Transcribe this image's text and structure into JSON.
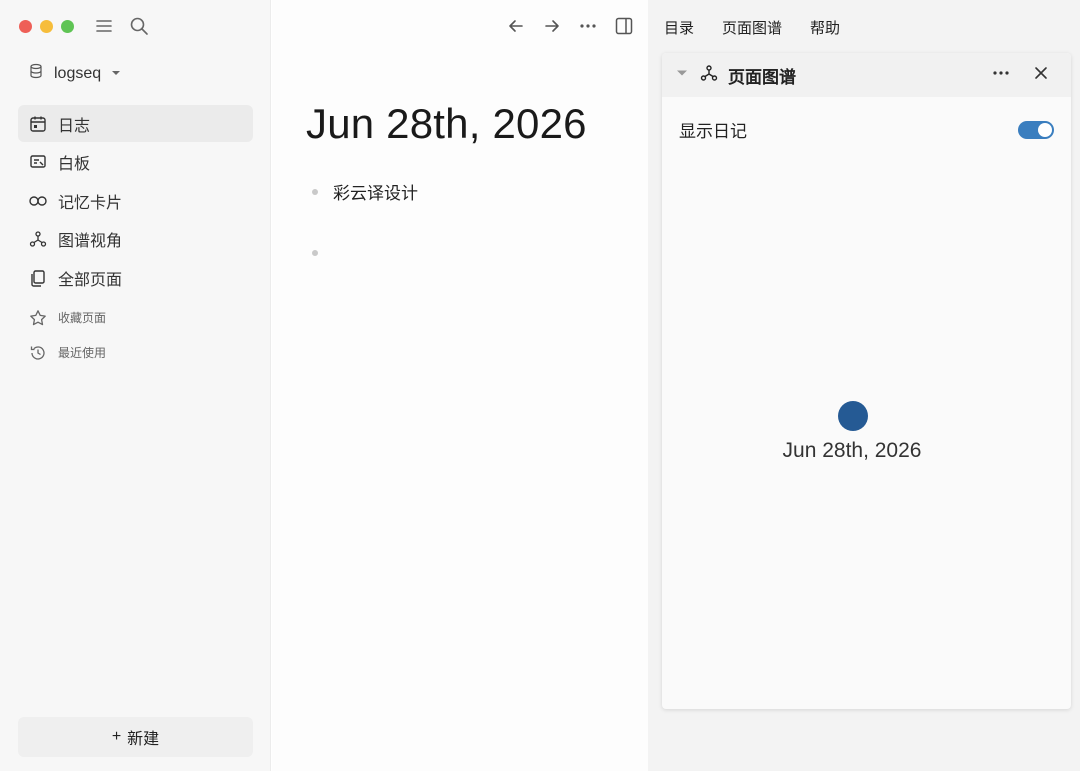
{
  "sidebar": {
    "workspace_name": "logseq",
    "nav": [
      {
        "label": "日志",
        "icon": "calendar-icon",
        "active": true
      },
      {
        "label": "白板",
        "icon": "whiteboard-icon",
        "active": false
      },
      {
        "label": "记忆卡片",
        "icon": "infinity-icon",
        "active": false
      },
      {
        "label": "图谱视角",
        "icon": "graph-icon",
        "active": false
      },
      {
        "label": "全部页面",
        "icon": "pages-icon",
        "active": false
      }
    ],
    "sub": [
      {
        "label": "收藏页面",
        "icon": "star-icon"
      },
      {
        "label": "最近使用",
        "icon": "history-icon"
      }
    ],
    "new_button": "新建",
    "new_button_plus": "+"
  },
  "main": {
    "page_title": "Jun 28th, 2026",
    "blocks": [
      "彩云译设计",
      ""
    ]
  },
  "right": {
    "menu": [
      "目录",
      "页面图谱",
      "帮助"
    ],
    "panel_title": "页面图谱",
    "toggle_label": "显示日记",
    "toggle_on": true,
    "graph_node_label": "Jun 28th, 2026",
    "graph_node_color": "#255a94"
  },
  "colors": {
    "accent": "#3a7ebf",
    "traffic_red": "#ee5f57",
    "traffic_yellow": "#f6bd3b",
    "traffic_green": "#5fc454"
  }
}
